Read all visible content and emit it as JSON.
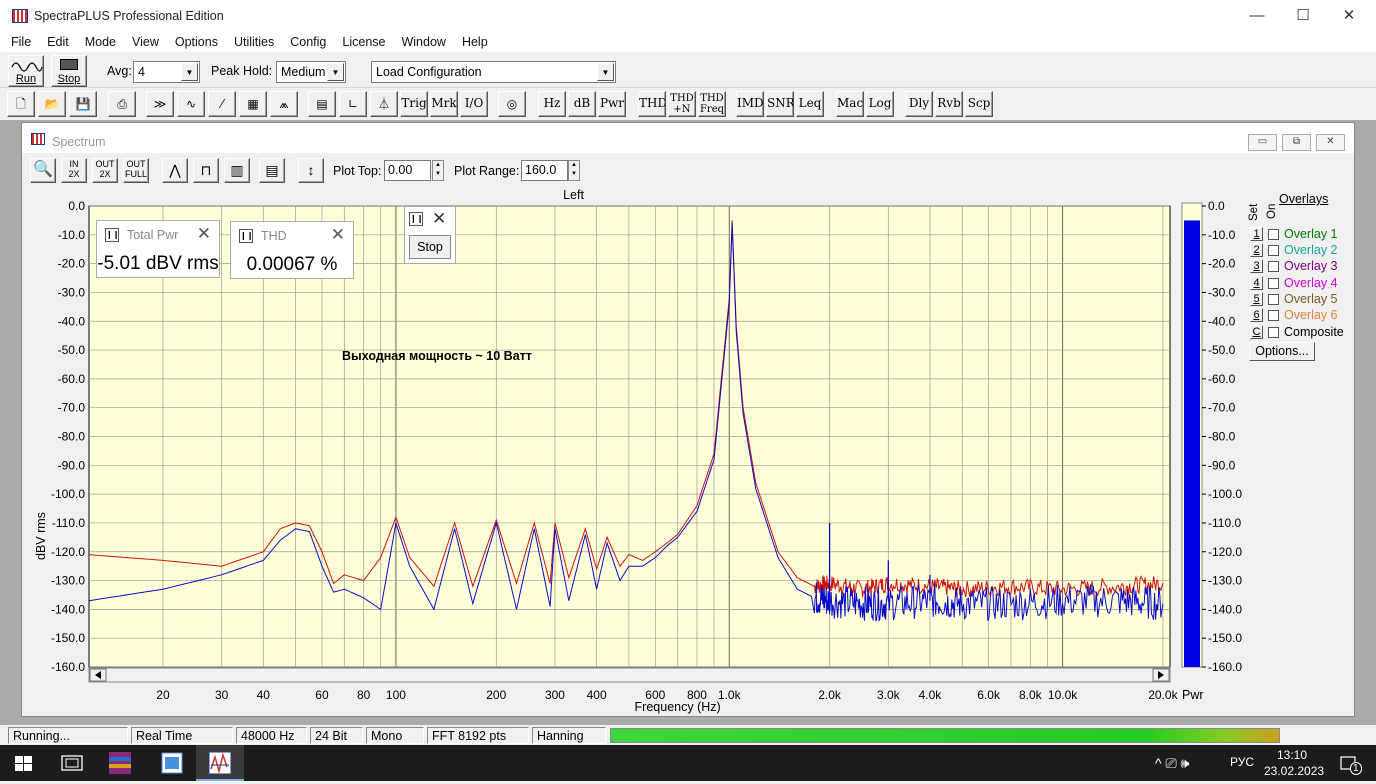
{
  "window": {
    "title": "SpectraPLUS Professional Edition",
    "minimize": "—",
    "maximize": "☐",
    "close": "✕"
  },
  "menu": [
    "File",
    "Edit",
    "Mode",
    "View",
    "Options",
    "Utilities",
    "Config",
    "License",
    "Window",
    "Help"
  ],
  "toolbar": {
    "run_label": "Run",
    "stop_label": "Stop",
    "avg_label": "Avg:",
    "avg_value": "4",
    "peakhold_label": "Peak Hold:",
    "peakhold_value": "Medium",
    "config_value": "Load Configuration"
  },
  "toolbar2": {
    "text_buttons": [
      "Trig",
      "Mrk",
      "I/O",
      "Hz",
      "dB",
      "Pwr",
      "THD",
      "THD +N",
      "THD Freq",
      "IMD",
      "SNR",
      "Leq",
      "Mac",
      "Log",
      "Dly",
      "Rvb",
      "Scp"
    ]
  },
  "spectrum": {
    "title": "Spectrum",
    "plot_top_label": "Plot Top:",
    "plot_top_value": "0.00",
    "plot_range_label": "Plot Range:",
    "plot_range_value": "160.0",
    "overlays_title": "Overlays",
    "set_label": "Set",
    "on_label": "On",
    "overlays": [
      {
        "num": "1",
        "label": "Overlay 1",
        "color": "#007a00"
      },
      {
        "num": "2",
        "label": "Overlay 2",
        "color": "#1aa0a0"
      },
      {
        "num": "3",
        "label": "Overlay 3",
        "color": "#800080"
      },
      {
        "num": "4",
        "label": "Overlay 4",
        "color": "#d000d0"
      },
      {
        "num": "5",
        "label": "Overlay 5",
        "color": "#7a5a20"
      },
      {
        "num": "6",
        "label": "Overlay 6",
        "color": "#e08040"
      },
      {
        "num": "C",
        "label": "Composite",
        "color": "#000000"
      }
    ],
    "options_label": "Options..."
  },
  "meters": {
    "total_pwr": {
      "title": "Total Pwr",
      "value": "-5.01 dBV rms"
    },
    "thd": {
      "title": "THD",
      "value": "0.00067 %"
    },
    "stop_button": "Stop"
  },
  "chart_data": {
    "type": "line",
    "title": "Left",
    "xlabel": "Frequency (Hz)",
    "ylabel": "dBV rms",
    "xscale": "log",
    "xlim": [
      12,
      21000
    ],
    "ylim": [
      -160,
      0
    ],
    "x_ticks": [
      "20",
      "30",
      "40",
      "60",
      "80",
      "100",
      "200",
      "300",
      "400",
      "600",
      "800",
      "1.0k",
      "2.0k",
      "3.0k",
      "4.0k",
      "6.0k",
      "8.0k",
      "10.0k",
      "20.0k"
    ],
    "y_ticks": [
      "0.0",
      "-10.0",
      "-20.0",
      "-30.0",
      "-40.0",
      "-50.0",
      "-60.0",
      "-70.0",
      "-80.0",
      "-90.0",
      "-100.0",
      "-110.0",
      "-120.0",
      "-130.0",
      "-140.0",
      "-150.0",
      "-160.0"
    ],
    "right_ticks": [
      "0.0",
      "-10.0",
      "-20.0",
      "-30.0",
      "-40.0",
      "-50.0",
      "-60.0",
      "-70.0",
      "-80.0",
      "-90.0",
      "-100.0",
      "-110.0",
      "-120.0",
      "-130.0",
      "-140.0",
      "-150.0",
      "-160.0"
    ],
    "pwr_label": "Pwr",
    "pwr_level_db": -5.01,
    "annotation": "Выходная мощность ~ 10 Ватт",
    "grid": true,
    "background": "#ffffd8",
    "series": [
      {
        "color": "#cc1111",
        "x": [
          12,
          20,
          30,
          40,
          45,
          50,
          55,
          60,
          65,
          70,
          80,
          90,
          100,
          110,
          130,
          150,
          170,
          200,
          230,
          260,
          290,
          300,
          330,
          370,
          400,
          430,
          470,
          500,
          550,
          600,
          650,
          700,
          800,
          900,
          1000,
          1020,
          1050,
          1100,
          1200,
          1400,
          1600,
          1800,
          2000,
          2500,
          3000,
          4000,
          5000,
          7000,
          10000,
          15000,
          20000
        ],
        "y": [
          -121,
          -123,
          -125,
          -120,
          -112,
          -110,
          -111,
          -120,
          -131,
          -128,
          -130,
          -122,
          -108,
          -122,
          -132,
          -110,
          -132,
          -109,
          -131,
          -110,
          -131,
          -110,
          -129,
          -112,
          -126,
          -115,
          -125,
          -121,
          -123,
          -120,
          -117,
          -114,
          -104,
          -86,
          -32,
          -5,
          -42,
          -70,
          -96,
          -120,
          -129,
          -132,
          -131,
          -133,
          -131,
          -132,
          -133,
          -132,
          -133,
          -132,
          -131
        ]
      },
      {
        "color": "#0a0acc",
        "x": [
          12,
          20,
          30,
          40,
          45,
          50,
          55,
          60,
          65,
          70,
          80,
          90,
          100,
          110,
          130,
          150,
          170,
          200,
          230,
          260,
          290,
          300,
          330,
          370,
          400,
          430,
          470,
          500,
          550,
          600,
          650,
          700,
          800,
          900,
          1000,
          1020,
          1050,
          1100,
          1200,
          1400,
          1600,
          1800,
          2000,
          2500,
          3000,
          4000,
          5000,
          7000,
          10000,
          15000,
          20000
        ],
        "y": [
          -137,
          -133,
          -128,
          -123,
          -116,
          -112,
          -113,
          -125,
          -134,
          -133,
          -136,
          -140,
          -110,
          -125,
          -140,
          -112,
          -138,
          -110,
          -140,
          -112,
          -139,
          -112,
          -137,
          -114,
          -133,
          -117,
          -130,
          -125,
          -125,
          -122,
          -118,
          -115,
          -106,
          -88,
          -34,
          -6,
          -44,
          -72,
          -98,
          -122,
          -133,
          -136,
          -137,
          -138,
          -138,
          -137,
          -138,
          -138,
          -137,
          -137,
          -138
        ]
      }
    ],
    "spikes": [
      {
        "x": 2000,
        "y": -110
      },
      {
        "x": 3000,
        "y": -123
      },
      {
        "x": 4000,
        "y": -128
      }
    ]
  },
  "statusbar": {
    "state": "Running...",
    "mode": "Real Time",
    "rate": "48000 Hz",
    "bits": "24 Bit",
    "channels": "Mono",
    "fft": "FFT 8192 pts",
    "window": "Hanning"
  },
  "taskbar": {
    "lang": "РУС",
    "time": "13:10",
    "date": "23.02.2023",
    "notifications": "1",
    "tray_glyphs": "^  ⎚  🕪"
  }
}
